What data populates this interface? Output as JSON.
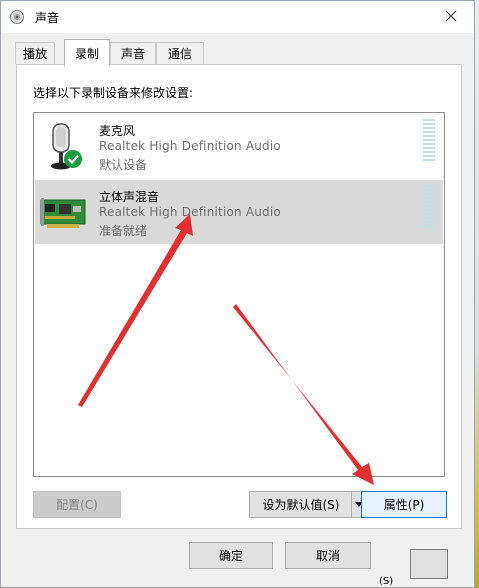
{
  "window": {
    "title": "声音",
    "close_icon": "close-icon"
  },
  "tabs": [
    {
      "label": "播放",
      "active": false
    },
    {
      "label": "录制",
      "active": true
    },
    {
      "label": "声音",
      "active": false
    },
    {
      "label": "通信",
      "active": false
    }
  ],
  "instruction": "选择以下录制设备来修改设置:",
  "devices": [
    {
      "name": "麦克风",
      "driver": "Realtek High Definition Audio",
      "status": "默认设备",
      "icon": "microphone-icon",
      "default": true,
      "selected": false
    },
    {
      "name": "立体声混音",
      "driver": "Realtek High Definition Audio",
      "status": "准备就绪",
      "icon": "sound-card-icon",
      "default": false,
      "selected": true
    }
  ],
  "buttons": {
    "configure": "配置(C)",
    "set_default": "设为默认值(S)",
    "properties": "属性(P)",
    "ok": "确定",
    "cancel": "取消",
    "apply_label": "(S)"
  },
  "colors": {
    "arrow": "#e0302f",
    "selection": "#d9d9d9",
    "accent": "#0078d7",
    "check": "#1a9b3f"
  }
}
